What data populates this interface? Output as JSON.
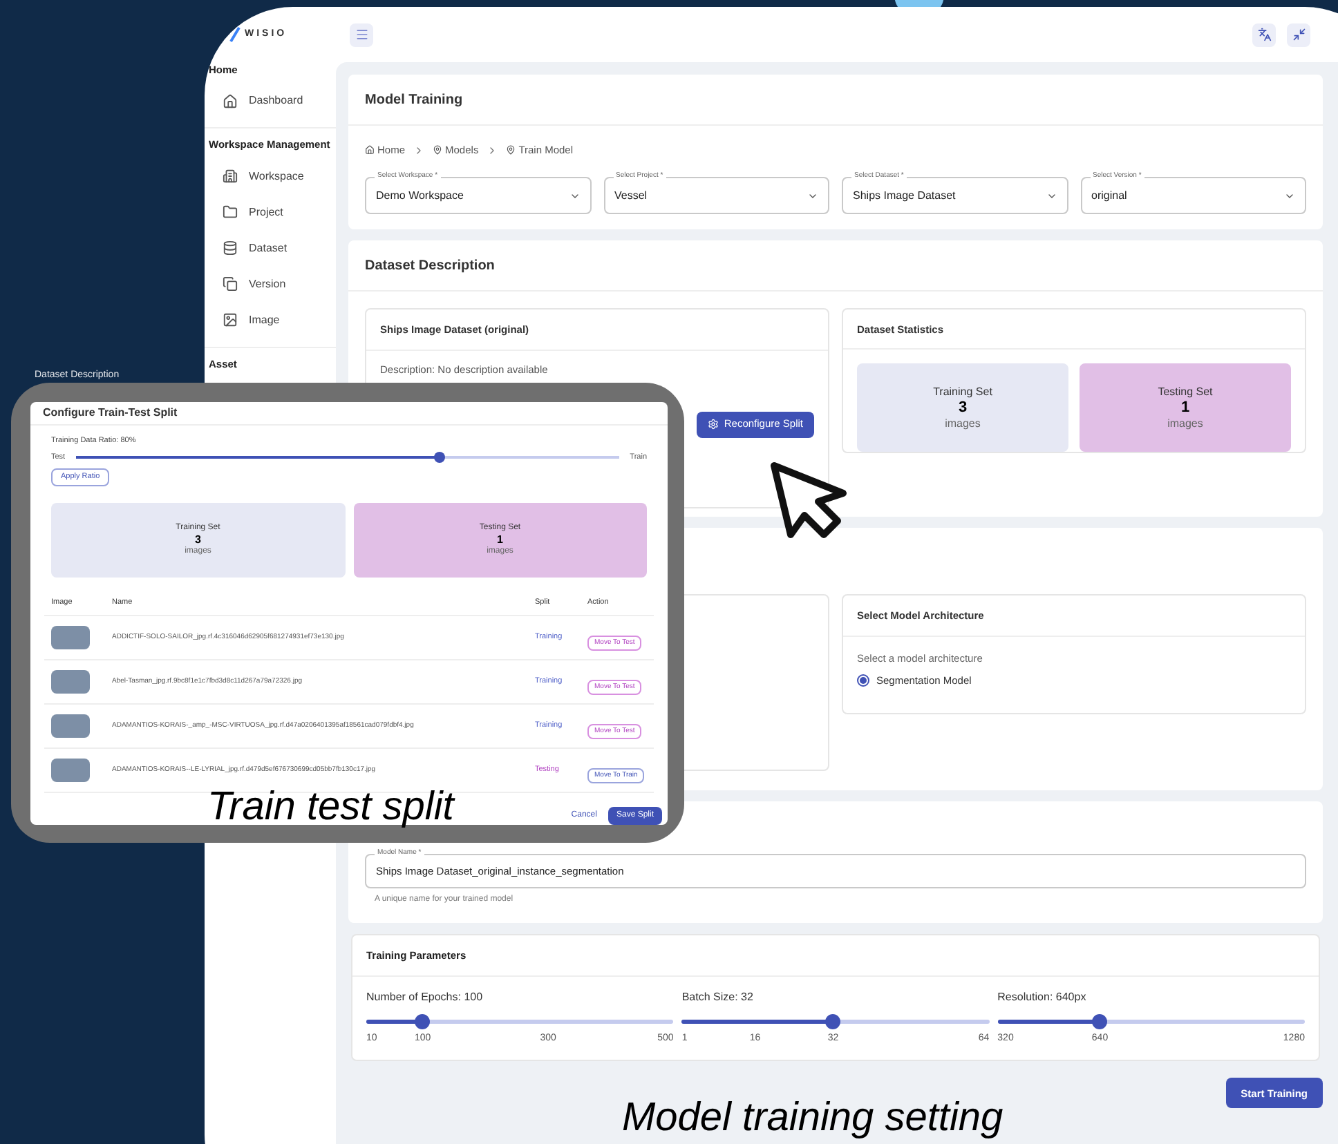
{
  "sidebar": {
    "logo": "WISIO",
    "sections": [
      {
        "title": "Home",
        "items": [
          {
            "label": "Dashboard"
          }
        ]
      },
      {
        "title": "Workspace Management",
        "items": [
          {
            "label": "Workspace"
          },
          {
            "label": "Project"
          },
          {
            "label": "Dataset"
          },
          {
            "label": "Version"
          },
          {
            "label": "Image"
          }
        ]
      },
      {
        "title": "Asset"
      }
    ]
  },
  "page": {
    "title": "Model Training",
    "breadcrumb": [
      "Home",
      "Models",
      "Train Model"
    ],
    "selects": [
      {
        "label": "Select Workspace *",
        "value": "Demo Workspace"
      },
      {
        "label": "Select Project *",
        "value": "Vessel"
      },
      {
        "label": "Select Dataset *",
        "value": "Ships Image Dataset"
      },
      {
        "label": "Select Version *",
        "value": "original"
      }
    ]
  },
  "dataset_description": {
    "title": "Dataset Description",
    "dataset_card": {
      "title": "Ships Image Dataset (original)",
      "description": "Description: No description available",
      "button": "Reconfigure Split"
    },
    "statistics": {
      "title": "Dataset Statistics",
      "sets": [
        {
          "label": "Training Set",
          "count": "3",
          "unit": "images",
          "kind": "train"
        },
        {
          "label": "Testing Set",
          "count": "1",
          "unit": "images",
          "kind": "test"
        }
      ]
    }
  },
  "architecture": {
    "title": "Select Model Architecture",
    "prompt": "Select a model architecture",
    "options": [
      {
        "label": "Segmentation Model",
        "selected": true
      }
    ]
  },
  "model_name": {
    "label": "Model Name *",
    "value": "Ships Image Dataset_original_instance_segmentation",
    "helper": "A unique name for your trained model"
  },
  "training_parameters": {
    "title": "Training Parameters",
    "sliders": [
      {
        "label": "Number of Epochs: 100",
        "level": 0.18,
        "ticks": [
          "10",
          "100",
          "300",
          "500"
        ]
      },
      {
        "label": "Batch Size: 32",
        "level": 0.49,
        "ticks": [
          "1",
          "16",
          "32",
          "64"
        ]
      },
      {
        "label": "Resolution: 640px",
        "level": 0.33,
        "ticks": [
          "320",
          "640",
          "1280"
        ]
      }
    ]
  },
  "start_button": "Start Training",
  "modal": {
    "context_label": "Dataset Description",
    "title": "Configure Train-Test Split",
    "ratio_label": "Training Data Ratio: 80%",
    "slider": {
      "left": "Test",
      "right": "Train",
      "level": 0.67
    },
    "apply": "Apply Ratio",
    "sets": [
      {
        "label": "Training Set",
        "count": "3",
        "unit": "images",
        "kind": "train"
      },
      {
        "label": "Testing Set",
        "count": "1",
        "unit": "images",
        "kind": "test"
      }
    ],
    "columns": [
      "Image",
      "Name",
      "Split",
      "Action"
    ],
    "rows": [
      {
        "name": "ADDICTIF-SOLO-SAILOR_jpg.rf.4c316046d62905f681274931ef73e130.jpg",
        "split": "Training",
        "kind": "train",
        "action": "Move To Test"
      },
      {
        "name": "Abel-Tasman_jpg.rf.9bc8f1e1c7fbd3d8c11d267a79a72326.jpg",
        "split": "Training",
        "kind": "train",
        "action": "Move To Test"
      },
      {
        "name": "ADAMANTIOS-KORAIS-_amp_-MSC-VIRTUOSA_jpg.rf.d47a0206401395af18561cad079fdbf4.jpg",
        "split": "Training",
        "kind": "train",
        "action": "Move To Test"
      },
      {
        "name": "ADAMANTIOS-KORAIS--LE-LYRIAL_jpg.rf.d479d5ef676730699cd05bb7fb130c17.jpg",
        "split": "Testing",
        "kind": "test",
        "action": "Move To Train"
      }
    ],
    "cancel": "Cancel",
    "save": "Save Split"
  },
  "captions": [
    "Train test split",
    "Model training setting"
  ]
}
